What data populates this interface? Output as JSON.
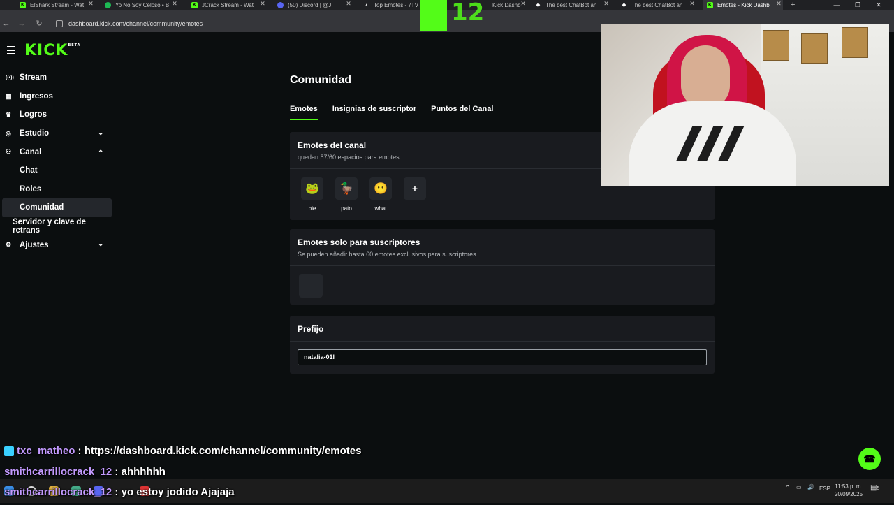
{
  "browser": {
    "tabs": [
      {
        "title": "ElShark Stream - Wat",
        "icon": "kick",
        "active": false
      },
      {
        "title": "Yo No Soy Celoso • B",
        "icon": "spotify",
        "active": false
      },
      {
        "title": "JCrack Stream - Wat",
        "icon": "kick",
        "active": false
      },
      {
        "title": "(50) Discord | @J",
        "icon": "discord",
        "active": false
      },
      {
        "title": "Top Emotes - 7TV",
        "icon": "7tv",
        "active": false
      },
      {
        "title": "Kick Dashb",
        "icon": "kick",
        "active": false
      },
      {
        "title": "The best ChatBot an",
        "icon": "chatbot",
        "active": false
      },
      {
        "title": "The best ChatBot an",
        "icon": "chatbot",
        "active": false
      },
      {
        "title": "Emotes - Kick Dashb",
        "icon": "kick",
        "active": true
      }
    ],
    "new_tab": "+",
    "url": "dashboard.kick.com/channel/community/emotes"
  },
  "app": {
    "logo": "KICK",
    "logo_badge": "BETA",
    "sidebar": [
      {
        "label": "Stream",
        "icon": "broadcast-icon",
        "glyph": "((•))"
      },
      {
        "label": "Ingresos",
        "icon": "wallet-icon",
        "glyph": "▦"
      },
      {
        "label": "Logros",
        "icon": "trophy-icon",
        "glyph": "🏆"
      },
      {
        "label": "Estudio",
        "icon": "studio-icon",
        "glyph": "◎",
        "chevron": "⌄"
      },
      {
        "label": "Canal",
        "icon": "channel-icon",
        "glyph": "⚇",
        "chevron": "⌃"
      },
      {
        "label": "Chat"
      },
      {
        "label": "Roles"
      },
      {
        "label": "Comunidad"
      },
      {
        "label": "Servidor y clave de retrans"
      },
      {
        "label": "Ajustes",
        "icon": "settings-icon",
        "glyph": "⚙",
        "chevron": "⌄"
      }
    ],
    "page_title": "Comunidad",
    "tabs": [
      "Emotes",
      "Insignias de suscriptor",
      "Puntos del Canal"
    ],
    "channel_emotes": {
      "title": "Emotes del canal",
      "subtitle": "quedan 57/60 espacios para emotes",
      "emotes": [
        {
          "name": "bie",
          "glyph": "🐸"
        },
        {
          "name": "pato",
          "glyph": "🦆"
        },
        {
          "name": "what",
          "glyph": "😶"
        }
      ],
      "add_label": "+"
    },
    "sub_emotes": {
      "title": "Emotes solo para suscriptores",
      "subtitle": "Se pueden añadir hasta 60 emotes exclusivos para suscriptores"
    },
    "prefix": {
      "title": "Prefijo",
      "value": "natalia-01l"
    },
    "support_glyph": "☎"
  },
  "chat": [
    {
      "user": "txc_matheo",
      "sep": " : ",
      "text": "https://dashboard.kick.com/channel/community/emotes",
      "badge": true
    },
    {
      "user": "smithcarrillocrack_12",
      "sep": " : ",
      "text": "ahhhhhh",
      "badge": false
    },
    {
      "user": "smithcarrillocrack_12",
      "sep": " : ",
      "text": "yo estoy jodido Ajajaja",
      "badge": false
    }
  ],
  "overlay": {
    "number": "12"
  },
  "taskbar": {
    "lang": "ESP",
    "time": "11:53 p. m.",
    "date": "20/09/2025",
    "notif_count": "5"
  },
  "colors": {
    "accent": "#53fc18",
    "chat_user": "#c39aff"
  }
}
